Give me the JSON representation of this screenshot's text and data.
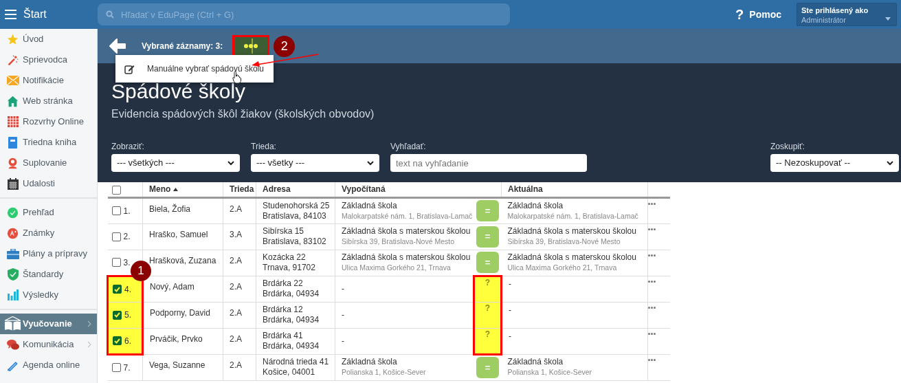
{
  "topbar": {
    "menu_label": "Štart",
    "search_placeholder": "Hľadať v EduPage (Ctrl + G)",
    "help_icon": "?",
    "help": "Pomoc",
    "user": {
      "caption": "Ste prihlásený ako",
      "name": "Administrátor"
    }
  },
  "sidebar": {
    "groups": [
      [
        {
          "label": "Úvod",
          "selected": false
        },
        {
          "label": "Sprievodca",
          "selected": false
        },
        {
          "label": "Notifikácie",
          "selected": false
        },
        {
          "label": "Web stránka",
          "selected": false
        },
        {
          "label": "Rozvrhy Online",
          "selected": false
        },
        {
          "label": "Triedna kniha",
          "selected": false
        },
        {
          "label": "Suplovanie",
          "selected": false
        },
        {
          "label": "Udalosti",
          "selected": false
        }
      ],
      [
        {
          "label": "Prehľad",
          "selected": false
        },
        {
          "label": "Známky",
          "selected": false
        },
        {
          "label": "Plány a prípravy",
          "selected": false
        },
        {
          "label": "Štandardy",
          "selected": false
        },
        {
          "label": "Výsledky",
          "selected": false
        }
      ],
      [
        {
          "label": "Vyučovanie",
          "selected": true,
          "expandable": true
        },
        {
          "label": "Komunikácia",
          "selected": false,
          "expandable": true
        },
        {
          "label": "Agenda online",
          "selected": false,
          "expandable": false
        }
      ]
    ]
  },
  "selection_bar": {
    "label": "Vybrané záznamy: 3:",
    "callout": "2"
  },
  "context_menu": {
    "items": [
      {
        "label": "Manuálne vybrať spádovú školu"
      }
    ]
  },
  "page": {
    "title": "Spádové školy",
    "subtitle": "Evidencia spádových škôl žiakov (školských obvodov)"
  },
  "filters": [
    {
      "kind": "select",
      "label": "Zobraziť:",
      "value": "--- všetkých ---"
    },
    {
      "kind": "select",
      "label": "Trieda:",
      "value": "--- všetky ---"
    },
    {
      "kind": "search",
      "label": "Vyhľadať:",
      "placeholder": "text na vyhľadanie"
    },
    {
      "kind": "select",
      "label": "Zoskupiť:",
      "value": "-- Nezoskupovať --"
    }
  ],
  "table": {
    "select_all_checked": false,
    "columns": [
      {
        "label": "Meno",
        "sorted": true
      },
      {
        "label": "Trieda",
        "sorted": false
      },
      {
        "label": "Adresa",
        "sorted": false
      },
      {
        "label": "Vypočítaná",
        "sorted": false
      },
      {
        "label": "Aktuálna",
        "sorted": false
      }
    ],
    "highlight_callout": "1",
    "rows": [
      {
        "number": "1.",
        "selected": false,
        "highlighted": false,
        "name": "Biela, Žofia",
        "class": "2.A",
        "address": [
          "Studenohorská 25",
          "Bratislava, 84103"
        ],
        "computed": {
          "name": "Základná škola",
          "address": "Malokarpatské nám. 1, Bratislava-Lamač"
        },
        "match": {
          "kind": "equal",
          "symbol": "="
        },
        "current": {
          "name": "Základná škola",
          "address": "Malokarpatské nám. 1, Bratislava-Lamač"
        }
      },
      {
        "number": "2.",
        "selected": false,
        "highlighted": false,
        "name": "Hraško, Samuel",
        "class": "3.A",
        "address": [
          "Sibírska 15",
          "Bratislava, 83102"
        ],
        "computed": {
          "name": "Základná škola s materskou školou",
          "address": "Sibírska 39, Bratislava-Nové Mesto"
        },
        "match": {
          "kind": "equal",
          "symbol": "="
        },
        "current": {
          "name": "Základná škola s materskou školou",
          "address": "Sibírska 39, Bratislava-Nové Mesto"
        }
      },
      {
        "number": "3.",
        "selected": false,
        "highlighted": false,
        "name": "Hrašková, Zuzana",
        "class": "2.A",
        "address": [
          "Kozácka 22",
          "Trnava, 91702"
        ],
        "computed": {
          "name": "Základná škola s materskou školou",
          "address": "Ulica Maxima Gorkého 21, Trnava"
        },
        "match": {
          "kind": "equal",
          "symbol": "="
        },
        "current": {
          "name": "Základná škola s materskou školou",
          "address": "Ulica Maxima Gorkého 21, Trnava"
        }
      },
      {
        "number": "4.",
        "selected": true,
        "highlighted": true,
        "name": "Nový, Adam",
        "class": "2.A",
        "address": [
          "Brdárka 22",
          "Brdárka, 04934"
        ],
        "computed": {
          "name": "-"
        },
        "match": {
          "kind": "unknown",
          "symbol": "?"
        },
        "current": {
          "name": "-"
        }
      },
      {
        "number": "5.",
        "selected": true,
        "highlighted": true,
        "name": "Podporny, David",
        "class": "2.A",
        "address": [
          "Brdárka 12",
          "Brdárka, 04934"
        ],
        "computed": {
          "name": "-"
        },
        "match": {
          "kind": "unknown",
          "symbol": "?"
        },
        "current": {
          "name": "-"
        }
      },
      {
        "number": "6.",
        "selected": true,
        "highlighted": true,
        "name": "Prváčik, Prvko",
        "class": "2.A",
        "address": [
          "Brdárka 41",
          "Brdárka, 04934"
        ],
        "computed": {
          "name": "-"
        },
        "match": {
          "kind": "unknown",
          "symbol": "?"
        },
        "current": {
          "name": "-"
        }
      },
      {
        "number": "7.",
        "selected": false,
        "highlighted": false,
        "name": "Vega, Suzanne",
        "class": "2.A",
        "address": [
          "Národná trieda 41",
          "Košice, 04001"
        ],
        "computed": {
          "name": "Základná škola",
          "address": "Polianska 1, Košice-Sever"
        },
        "match": {
          "kind": "equal",
          "symbol": "="
        },
        "current": {
          "name": "Základná škola",
          "address": "Polianska 1, Košice-Sever"
        }
      }
    ]
  }
}
